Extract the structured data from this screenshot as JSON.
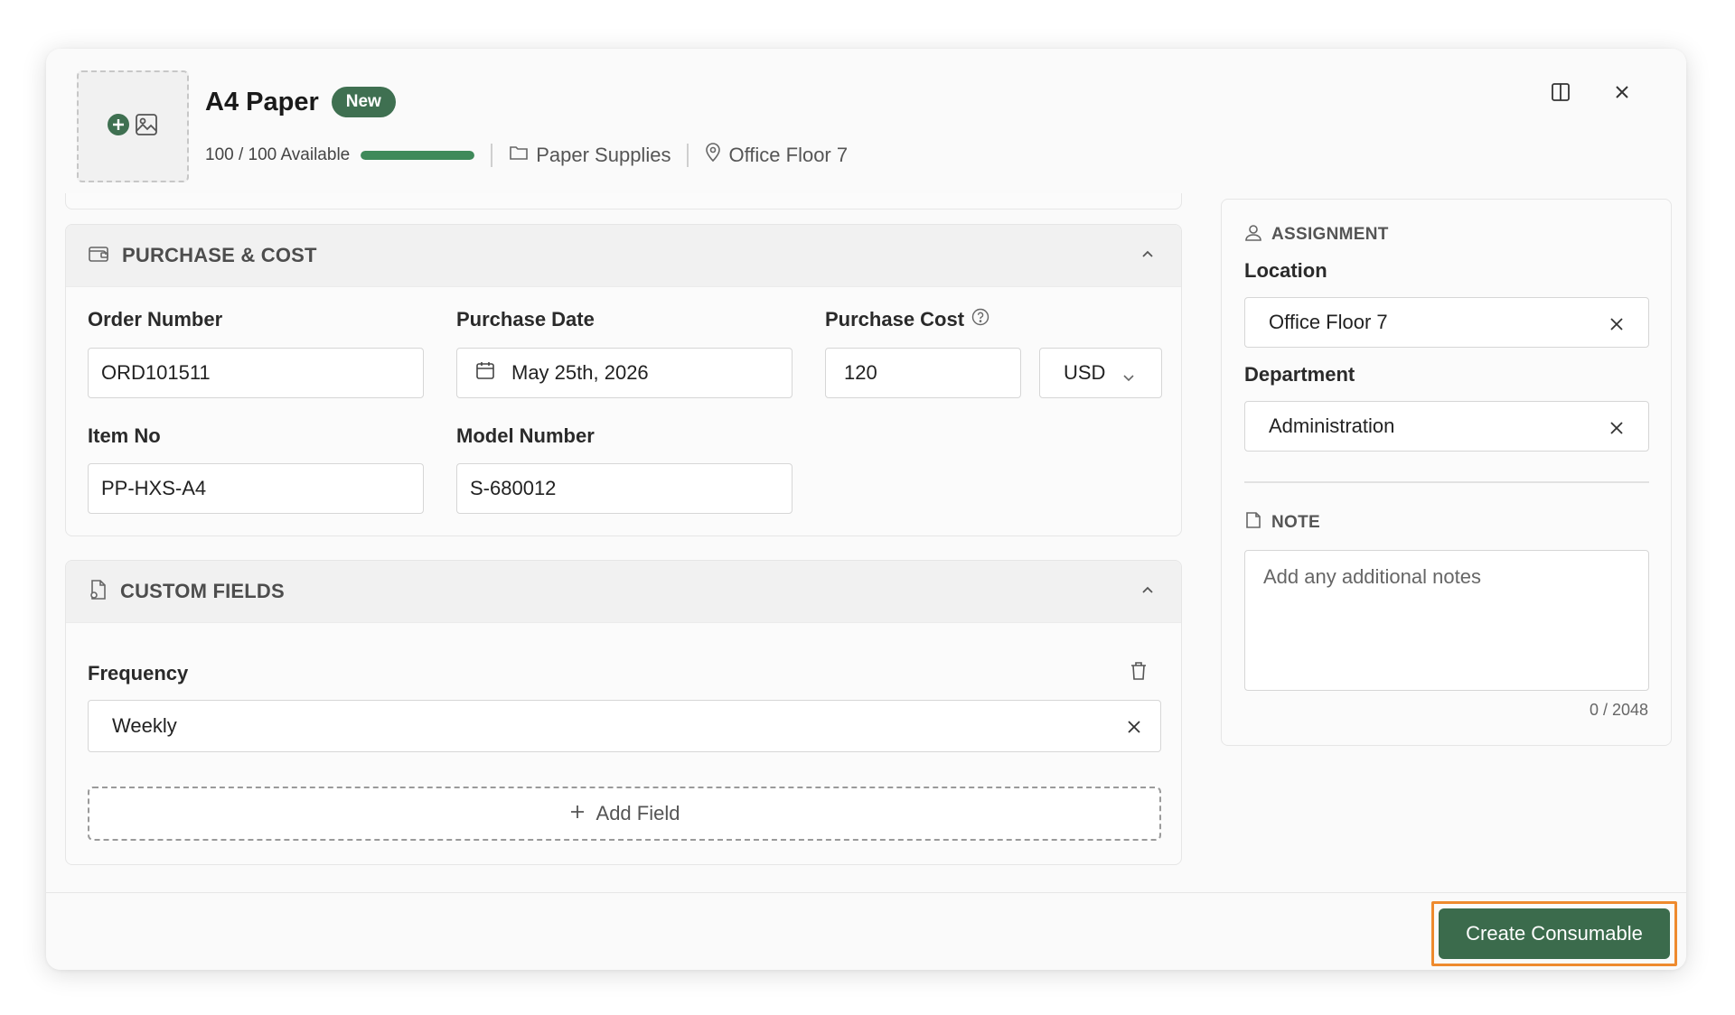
{
  "header": {
    "title": "A4 Paper",
    "badge": "New",
    "availability": "100 / 100 Available",
    "availability_fraction": 1.0,
    "category": "Paper Supplies",
    "location": "Office Floor 7"
  },
  "purchase": {
    "section_title": "PURCHASE & COST",
    "order_number_label": "Order Number",
    "order_number": "ORD101511",
    "purchase_date_label": "Purchase Date",
    "purchase_date": "May 25th, 2026",
    "purchase_cost_label": "Purchase Cost",
    "purchase_cost": "120",
    "currency": "USD",
    "item_no_label": "Item No",
    "item_no": "PP-HXS-A4",
    "model_number_label": "Model Number",
    "model_number": "S-680012"
  },
  "custom_fields": {
    "section_title": "CUSTOM FIELDS",
    "field_label": "Frequency",
    "field_value": "Weekly",
    "add_field_label": "Add Field"
  },
  "assignment": {
    "section_title": "ASSIGNMENT",
    "location_label": "Location",
    "location_value": "Office Floor 7",
    "department_label": "Department",
    "department_value": "Administration"
  },
  "note": {
    "section_title": "NOTE",
    "placeholder": "Add any additional notes",
    "counter": "0 / 2048"
  },
  "footer": {
    "create_label": "Create Consumable"
  },
  "colors": {
    "brand_green": "#3b6b4c",
    "progress_green": "#3f8a5a",
    "highlight_orange": "#ee8a2e"
  }
}
